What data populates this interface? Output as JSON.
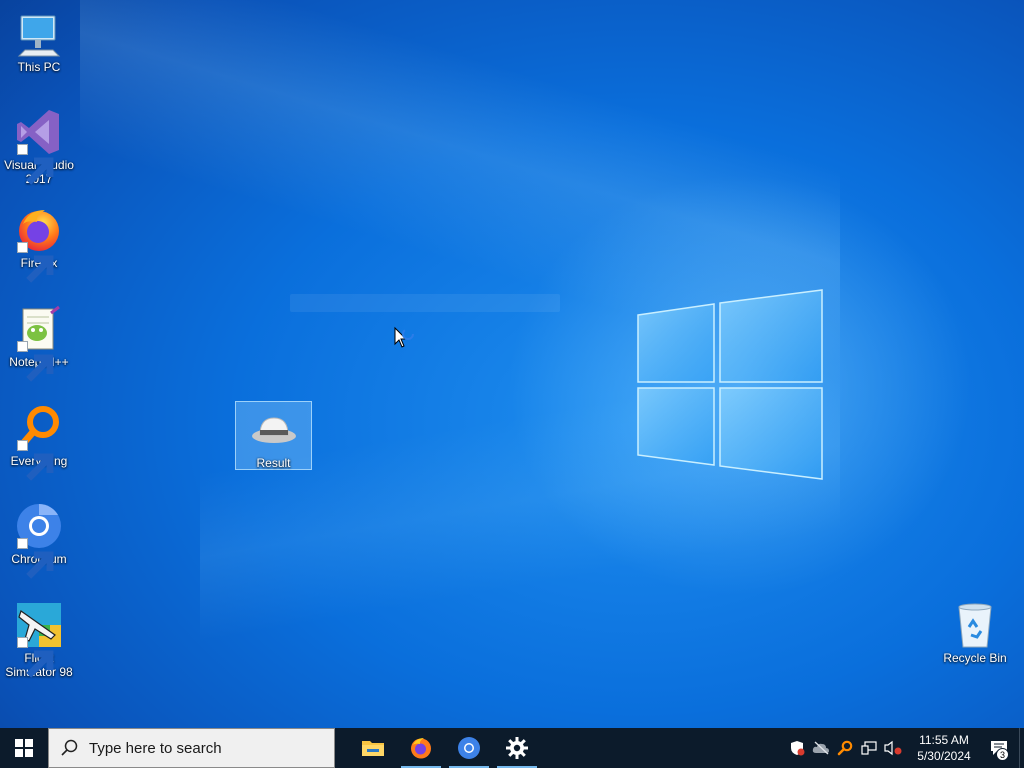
{
  "desktop": {
    "icons": [
      {
        "label": "This PC",
        "icon": "computer-icon"
      },
      {
        "label": "Visual Studio 2017",
        "icon": "visual-studio-icon"
      },
      {
        "label": "Firefox",
        "icon": "firefox-icon"
      },
      {
        "label": "Notepad++",
        "icon": "notepadpp-icon"
      },
      {
        "label": "Everything",
        "icon": "search-magnifier-icon"
      },
      {
        "label": "Chromium",
        "icon": "chromium-icon"
      },
      {
        "label": "Flight Simulator 98",
        "icon": "airplane-icon"
      },
      {
        "label": "Result",
        "icon": "hat-icon"
      },
      {
        "label": "Recycle Bin",
        "icon": "recycle-bin-icon"
      }
    ]
  },
  "taskbar": {
    "search_placeholder": "Type here to search",
    "pinned_apps": [
      {
        "name": "File Explorer",
        "icon": "folder-icon",
        "active": false
      },
      {
        "name": "Firefox",
        "icon": "firefox-icon",
        "active": true
      },
      {
        "name": "Chromium",
        "icon": "chromium-icon",
        "active": true
      },
      {
        "name": "Settings",
        "icon": "gear-icon",
        "active": true
      }
    ],
    "tray": {
      "time": "11:55 AM",
      "date": "5/30/2024",
      "notification_count": "3"
    }
  },
  "colors": {
    "taskbar_bg": "#0c1b2b",
    "wallpaper_blue": "#0a6fdc",
    "active_indicator": "#76b9ed"
  }
}
